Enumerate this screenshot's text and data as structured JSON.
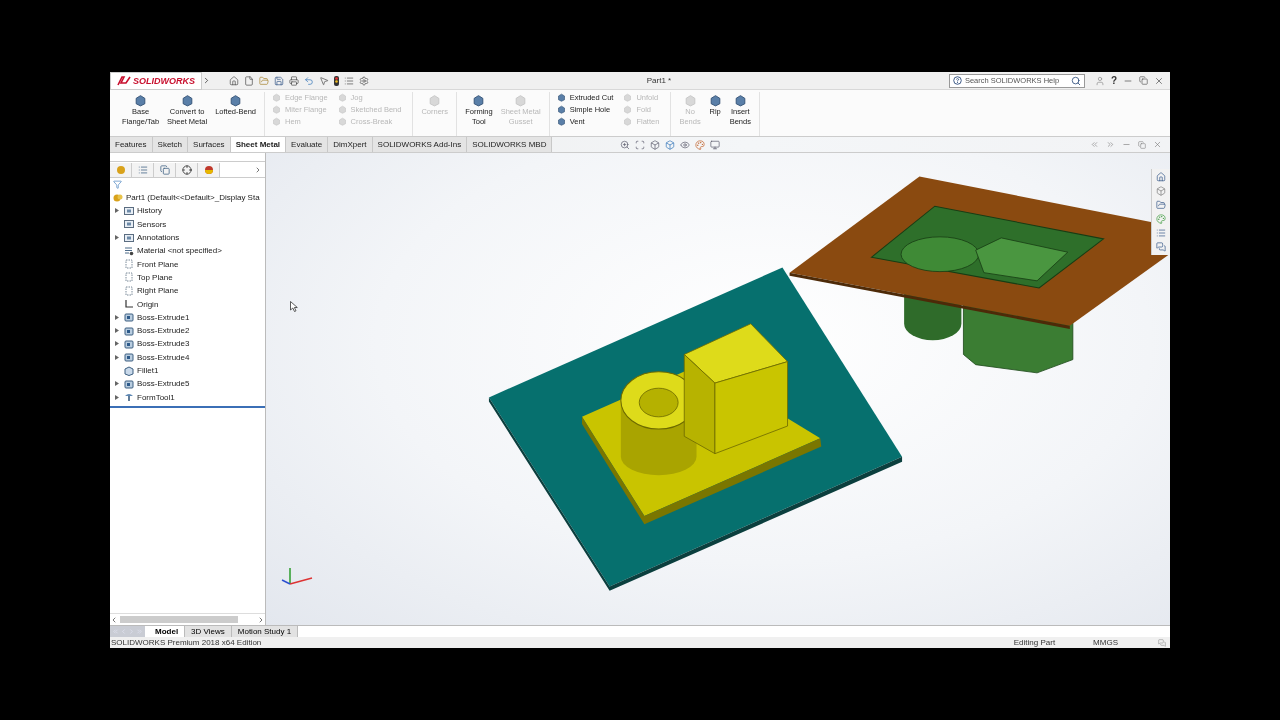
{
  "app": {
    "logo": "SOLIDWORKS",
    "title": "Part1 *",
    "search_placeholder": "Search SOLIDWORKS Help",
    "help_glyph": "?"
  },
  "ribbon": {
    "groups": [
      {
        "kind": "large",
        "items": [
          {
            "label": "Base\nFlange/Tab",
            "disabled": false
          },
          {
            "label": "Convert to\nSheet Metal",
            "disabled": false
          },
          {
            "label": "Lofted-Bend",
            "disabled": false
          }
        ]
      },
      {
        "kind": "small",
        "columns": [
          [
            {
              "label": "Edge Flange",
              "disabled": true
            },
            {
              "label": "Miter Flange",
              "disabled": true
            },
            {
              "label": "Hem",
              "disabled": true
            }
          ],
          [
            {
              "label": "Jog",
              "disabled": true
            },
            {
              "label": "Sketched Bend",
              "disabled": true
            },
            {
              "label": "Cross-Break",
              "disabled": true
            }
          ]
        ]
      },
      {
        "kind": "large",
        "items": [
          {
            "label": "Corners",
            "disabled": true
          }
        ]
      },
      {
        "kind": "large",
        "items": [
          {
            "label": "Forming\nTool",
            "disabled": false
          },
          {
            "label": "Sheet Metal\nGusset",
            "disabled": true
          }
        ]
      },
      {
        "kind": "small",
        "columns": [
          [
            {
              "label": "Extruded Cut",
              "disabled": false
            },
            {
              "label": "Simple Hole",
              "disabled": false
            },
            {
              "label": "Vent",
              "disabled": false
            }
          ],
          [
            {
              "label": "Unfold",
              "disabled": true
            },
            {
              "label": "Fold",
              "disabled": true
            },
            {
              "label": "Flatten",
              "disabled": true
            }
          ]
        ]
      },
      {
        "kind": "large",
        "items": [
          {
            "label": "No\nBends",
            "disabled": true
          },
          {
            "label": "Rip",
            "disabled": false
          },
          {
            "label": "Insert\nBends",
            "disabled": false
          }
        ]
      }
    ]
  },
  "tabs": [
    {
      "label": "Features",
      "selected": false
    },
    {
      "label": "Sketch",
      "selected": false
    },
    {
      "label": "Surfaces",
      "selected": false
    },
    {
      "label": "Sheet Metal",
      "selected": true
    },
    {
      "label": "Evaluate",
      "selected": false
    },
    {
      "label": "DimXpert",
      "selected": false
    },
    {
      "label": "SOLIDWORKS Add-Ins",
      "selected": false
    },
    {
      "label": "SOLIDWORKS MBD",
      "selected": false
    }
  ],
  "tree": {
    "root": "Part1  (Default<<Default>_Display Sta",
    "items": [
      {
        "label": "History",
        "kind": "folder",
        "expandable": true
      },
      {
        "label": "Sensors",
        "kind": "folder",
        "expandable": false
      },
      {
        "label": "Annotations",
        "kind": "folder",
        "expandable": true
      },
      {
        "label": "Material <not specified>",
        "kind": "material",
        "expandable": false
      },
      {
        "label": "Front Plane",
        "kind": "plane",
        "expandable": false
      },
      {
        "label": "Top Plane",
        "kind": "plane",
        "expandable": false
      },
      {
        "label": "Right Plane",
        "kind": "plane",
        "expandable": false
      },
      {
        "label": "Origin",
        "kind": "origin",
        "expandable": false
      },
      {
        "label": "Boss-Extrude1",
        "kind": "feature",
        "expandable": true
      },
      {
        "label": "Boss-Extrude2",
        "kind": "feature",
        "expandable": true
      },
      {
        "label": "Boss-Extrude3",
        "kind": "feature",
        "expandable": true
      },
      {
        "label": "Boss-Extrude4",
        "kind": "feature",
        "expandable": true
      },
      {
        "label": "Fillet1",
        "kind": "fillet",
        "expandable": false
      },
      {
        "label": "Boss-Extrude5",
        "kind": "feature",
        "expandable": true
      },
      {
        "label": "FormTool1",
        "kind": "formtool",
        "expandable": true
      }
    ]
  },
  "bottom_tabs": [
    {
      "label": "Model",
      "selected": true
    },
    {
      "label": "3D Views",
      "selected": false
    },
    {
      "label": "Motion Study 1",
      "selected": false
    }
  ],
  "status_bar": {
    "edition": "SOLIDWORKS Premium 2018 x64 Edition",
    "mode": "Editing Part",
    "units": "MMGS"
  }
}
